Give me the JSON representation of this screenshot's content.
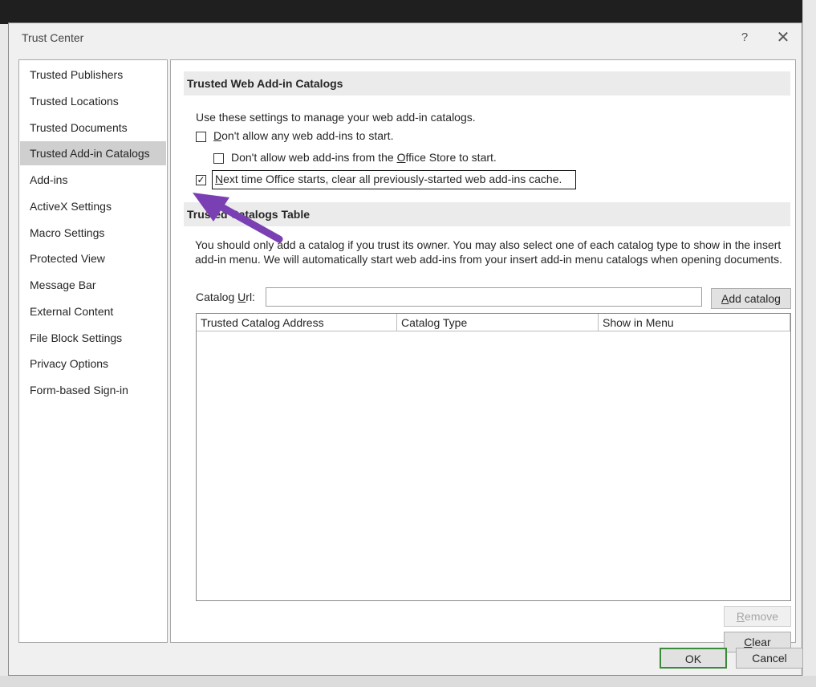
{
  "dialog": {
    "title": "Trust Center",
    "help_glyph": "?",
    "close_glyph": "✕"
  },
  "nav": {
    "items": [
      {
        "label": "Trusted Publishers"
      },
      {
        "label": "Trusted Locations"
      },
      {
        "label": "Trusted Documents"
      },
      {
        "label": "Trusted Add-in Catalogs",
        "selected": true
      },
      {
        "label": "Add-ins"
      },
      {
        "label": "ActiveX Settings"
      },
      {
        "label": "Macro Settings"
      },
      {
        "label": "Protected View"
      },
      {
        "label": "Message Bar"
      },
      {
        "label": "External Content"
      },
      {
        "label": "File Block Settings"
      },
      {
        "label": "Privacy Options"
      },
      {
        "label": "Form-based Sign-in"
      }
    ]
  },
  "web_catalogs": {
    "heading": "Trusted Web Add-in Catalogs",
    "intro": "Use these settings to manage your web add-in catalogs.",
    "opt1": {
      "accel": "D",
      "rest": "on't allow any web add-ins to start.",
      "checked": false
    },
    "opt2": {
      "pre": "Don't allow web add-ins from the ",
      "accel": "O",
      "rest": "ffice Store to start.",
      "checked": false
    },
    "opt3": {
      "accel": "N",
      "rest": "ext time Office starts, clear all previously-started web add-ins cache.",
      "checked": true,
      "check_glyph": "✓"
    }
  },
  "catalogs_table": {
    "heading": "Trusted Catalogs Table",
    "description": "You should only add a catalog if you trust its owner. You may also select one of each catalog type to show in the insert add-in menu. We will automatically start web add-ins from your insert add-in menu catalogs when opening documents.",
    "url_label_pre": "Catalog ",
    "url_label_accel": "U",
    "url_label_rest": "rl:",
    "url_value": "",
    "add_button": {
      "accel": "A",
      "rest": "dd catalog"
    },
    "columns": [
      "Trusted Catalog Address",
      "Catalog Type",
      "Show in Menu"
    ],
    "rows": [],
    "remove_button": {
      "accel": "R",
      "rest": "emove"
    },
    "clear_button": {
      "accel": "C",
      "rest": "lear"
    }
  },
  "footer": {
    "ok": "OK",
    "cancel": "Cancel"
  },
  "colors": {
    "annotation_arrow": "#7b3fb4"
  }
}
